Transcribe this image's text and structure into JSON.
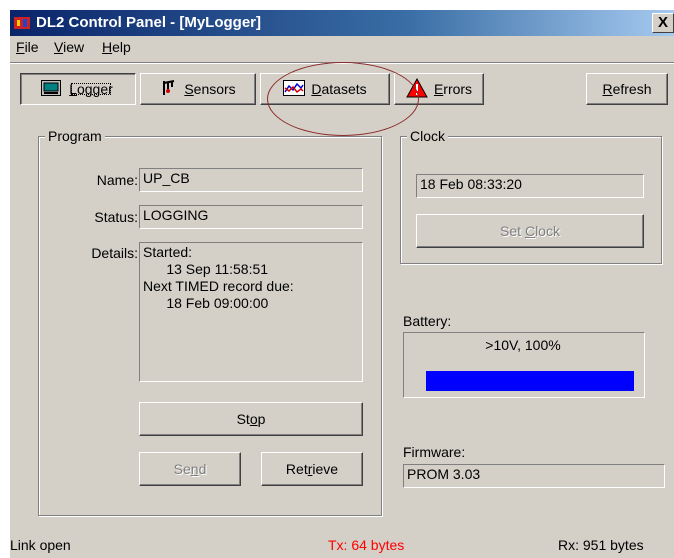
{
  "window": {
    "title": "DL2 Control Panel - [MyLogger]",
    "close_label": "X"
  },
  "menu": [
    {
      "first": "F",
      "rest": "ile"
    },
    {
      "first": "V",
      "rest": "iew"
    },
    {
      "first": "H",
      "rest": "elp"
    }
  ],
  "toolbar": {
    "logger": {
      "first": "L",
      "rest": "ogger"
    },
    "sensors": {
      "first": "S",
      "rest": "ensors"
    },
    "datasets": {
      "first": "D",
      "rest": "atasets"
    },
    "errors": {
      "first": "E",
      "rest": "rrors"
    },
    "refresh": {
      "first": "R",
      "rest": "efresh"
    }
  },
  "program": {
    "group_title": "Program",
    "name_label": "Name:",
    "name_value": "UP_CB",
    "status_label": "Status:",
    "status_value": "LOGGING",
    "details_label": "Details:",
    "details_value": "Started:\n      13 Sep 11:58:51\nNext TIMED record due:\n      18 Feb 09:00:00",
    "stop": {
      "pre": "St",
      "u": "o",
      "post": "p"
    },
    "send": {
      "pre": "Se",
      "u": "n",
      "post": "d"
    },
    "retrieve": {
      "pre": "Ret",
      "u": "r",
      "post": "ieve"
    }
  },
  "clock": {
    "group_title": "Clock",
    "value": "18 Feb 08:33:20",
    "set_clock": {
      "pre": "Set ",
      "u": "C",
      "post": "lock"
    }
  },
  "battery": {
    "label": "Battery:",
    "value_text": ">10V, 100%",
    "level_percent": 100,
    "bar_color": "#0000ff"
  },
  "firmware": {
    "label": "Firmware:",
    "value": "PROM 3.03"
  },
  "status": {
    "link": "Link open",
    "tx": "Tx: 64 bytes",
    "tx_color": "#ff0000",
    "rx": "Rx: 951 bytes"
  }
}
